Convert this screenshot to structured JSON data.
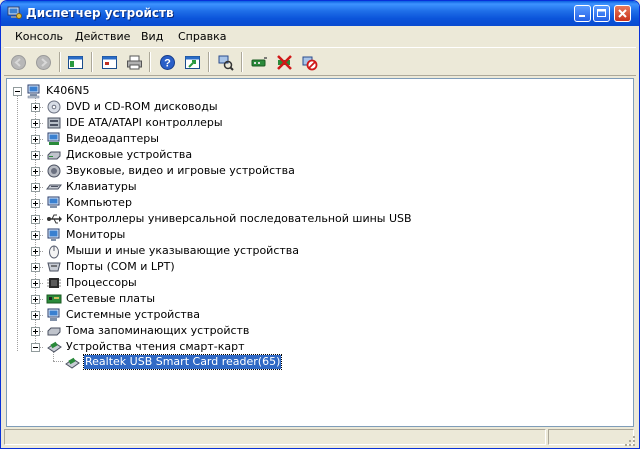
{
  "window": {
    "title": "Диспетчер устройств"
  },
  "menu": [
    "Консоль",
    "Действие",
    "Вид",
    "Справка"
  ],
  "toolbar": [
    {
      "name": "back-button",
      "icon": "back-arrow-icon"
    },
    {
      "name": "forward-button",
      "icon": "forward-arrow-icon"
    },
    {
      "name": "show-hide-tree-button",
      "icon": "console-tree-icon"
    },
    {
      "name": "properties-button",
      "icon": "properties-icon"
    },
    {
      "name": "print-button",
      "icon": "printer-icon"
    },
    {
      "name": "help-button",
      "icon": "help-icon"
    },
    {
      "name": "export-list-button",
      "icon": "export-icon"
    },
    {
      "name": "scan-hardware-button",
      "icon": "scan-hardware-icon"
    },
    {
      "name": "update-driver-button",
      "icon": "update-driver-icon"
    },
    {
      "name": "uninstall-button",
      "icon": "uninstall-icon"
    },
    {
      "name": "disable-button",
      "icon": "disable-device-icon"
    }
  ],
  "tree": {
    "root": {
      "label": "K406N5",
      "icon": "computer-icon"
    },
    "categories": [
      {
        "label": "DVD и CD-ROM дисководы",
        "icon": "cdrom-icon"
      },
      {
        "label": "IDE ATA/ATAPI контроллеры",
        "icon": "ide-controller-icon"
      },
      {
        "label": "Видеоадаптеры",
        "icon": "display-adapter-icon"
      },
      {
        "label": "Дисковые устройства",
        "icon": "disk-drive-icon"
      },
      {
        "label": "Звуковые, видео и игровые устройства",
        "icon": "sound-icon"
      },
      {
        "label": "Клавиатуры",
        "icon": "keyboard-icon"
      },
      {
        "label": "Компьютер",
        "icon": "computer-icon"
      },
      {
        "label": "Контроллеры универсальной последовательной шины USB",
        "icon": "usb-icon"
      },
      {
        "label": "Мониторы",
        "icon": "monitor-icon"
      },
      {
        "label": "Мыши и иные указывающие устройства",
        "icon": "mouse-icon"
      },
      {
        "label": "Порты (COM и LPT)",
        "icon": "port-icon"
      },
      {
        "label": "Процессоры",
        "icon": "processor-icon"
      },
      {
        "label": "Сетевые платы",
        "icon": "network-card-icon"
      },
      {
        "label": "Системные устройства",
        "icon": "system-device-icon"
      },
      {
        "label": "Тома запоминающих устройств",
        "icon": "storage-volume-icon"
      },
      {
        "label": "Устройства чтения смарт-карт",
        "icon": "smart-card-reader-icon",
        "expanded": true,
        "children": [
          {
            "label": "Realtek USB Smart Card reader(65)",
            "icon": "smart-card-reader-icon",
            "selected": true
          }
        ]
      }
    ]
  },
  "colors": {
    "titlebar": "#0a5fe0",
    "selection": "#316ac5",
    "face": "#ece9d8"
  }
}
